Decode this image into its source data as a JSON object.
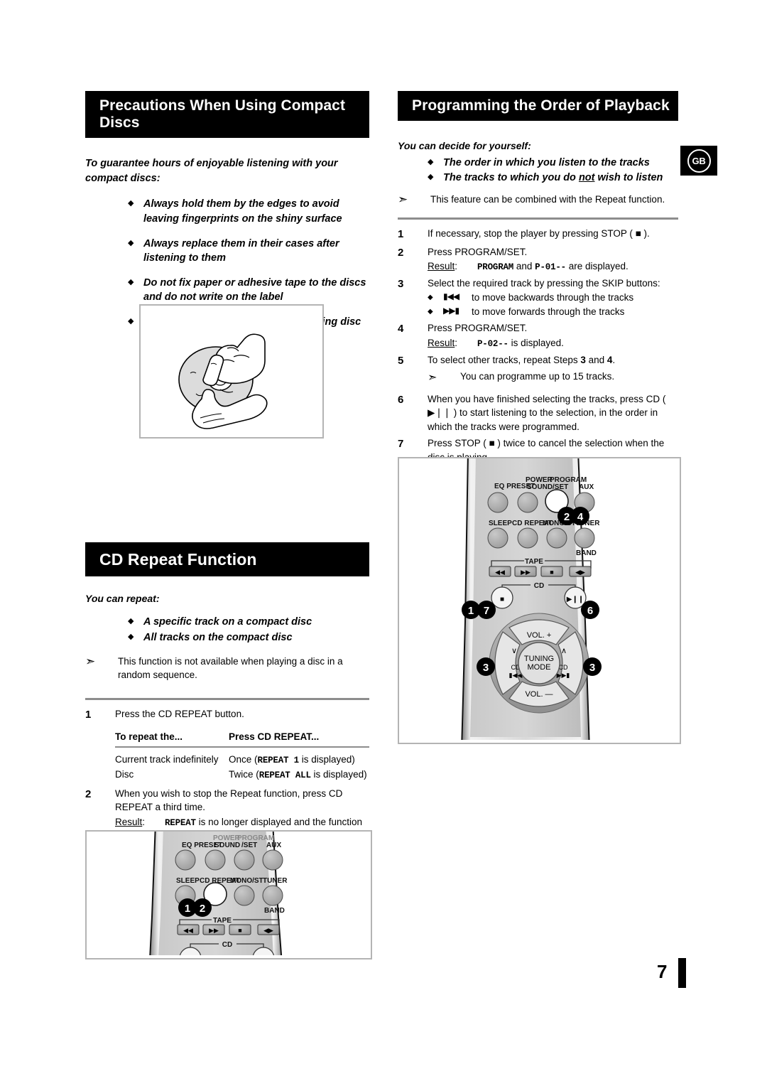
{
  "page": {
    "number": "7",
    "region_badge": "GB"
  },
  "left_column": {
    "section1": {
      "title": "Precautions When Using Compact Discs",
      "intro": "To guarantee hours of enjoyable listening with your compact discs:",
      "bullets": [
        "Always hold them by the edges to avoid leaving fingerprints on the shiny surface",
        "Always replace them in their cases after listening to them",
        "Do not fix paper or adhesive tape to the discs and do not write on the label",
        "Clean the player with a special cleaning disc"
      ],
      "illustration_alt": "Hands cleaning a compact disc with a cloth"
    },
    "section2": {
      "title": "CD Repeat Function",
      "lead": "You can repeat:",
      "bullets": [
        "A specific track on a compact disc",
        "All tracks on the compact disc"
      ],
      "note": "This function is not available when playing a disc in a random sequence.",
      "steps": [
        {
          "num": "1",
          "text": "Press the CD REPEAT button."
        },
        {
          "num": "2",
          "text": "When you wish to stop the Repeat function, press CD REPEAT a third time.",
          "result_label": "Result",
          "result_mono": "REPEAT",
          "result_text": "is no longer displayed and the function is cancelled."
        }
      ],
      "table": {
        "headers": [
          "To repeat the...",
          "Press CD REPEAT..."
        ],
        "rows": [
          {
            "what": "Current track indefinitely",
            "press_pre": "Once (",
            "press_mono": "REPEAT 1",
            "press_post": "is displayed)"
          },
          {
            "what": "Disc",
            "press_pre": "Twice (",
            "press_mono": "REPEAT ALL",
            "press_post": "is displayed)"
          }
        ]
      }
    }
  },
  "right_column": {
    "section": {
      "title": "Programming the Order of Playback",
      "lead": "You can decide for yourself:",
      "bullets": [
        "The order in which you listen to the tracks",
        "The tracks to which you do not wish to listen"
      ],
      "bullet2_parts": {
        "pre": "The tracks to which you do ",
        "underlined": "not",
        "post": " wish to listen"
      },
      "note": "This feature can be combined with the Repeat function.",
      "steps": [
        {
          "num": "1",
          "text": "If necessary, stop the player by pressing STOP ( ■ )."
        },
        {
          "num": "2",
          "text": "Press PROGRAM/SET.",
          "result_label": "Result",
          "result_mono_1": "PROGRAM",
          "result_mid": "and",
          "result_mono_2": "P-01--",
          "result_text": "are displayed."
        },
        {
          "num": "3",
          "text": "Select the required track by pressing the SKIP buttons:",
          "sub_bullets": [
            {
              "symbol": "skip-back-icon",
              "text": "to move backwards through the tracks"
            },
            {
              "symbol": "skip-forward-icon",
              "text": "to move forwards through the tracks"
            }
          ]
        },
        {
          "num": "4",
          "text": "Press PROGRAM/SET.",
          "result_label": "Result",
          "result_mono": "P-02--",
          "result_text": "is displayed."
        },
        {
          "num": "5",
          "text_pre": "To select other tracks, repeat Steps ",
          "ref1": "3",
          "text_mid": " and ",
          "ref2": "4",
          "text_post": ".",
          "note": "You can programme up to 15 tracks."
        },
        {
          "num": "6",
          "text": "When you have finished selecting the tracks, press CD ( ▶❘❘ ) to start listening to the selection, in the order in which the tracks were programmed."
        },
        {
          "num": "7",
          "text": "Press STOP ( ■ ) twice to cancel the selection when the disc is playing."
        }
      ]
    }
  },
  "remote_right": {
    "callouts": [
      "2",
      "4",
      "1",
      "7",
      "6",
      "3",
      "3"
    ],
    "buttons": {
      "row1": [
        "EQ PRESET",
        "POWER SOUND",
        "PROGRAM /SET",
        "AUX"
      ],
      "row2": [
        "SLEEP",
        "CD REPEAT",
        "MONO/ST",
        "TUNER"
      ],
      "row2_sub": "BAND",
      "tape_label": "TAPE",
      "cd_label": "CD",
      "vol_up": "VOL. +",
      "vol_down": "VOL. —",
      "tuning": "TUNING MODE",
      "tuning_line1": "TUNING",
      "tuning_line2": "MODE",
      "cd_left": "CD",
      "cd_right": "CD"
    },
    "highlighted": "PROGRAM /SET"
  },
  "remote_left": {
    "callouts": [
      "1",
      "2"
    ],
    "buttons": {
      "row1": [
        "EQ PRESET",
        "POWER SOUND",
        "PROGRAM /SET",
        "AUX"
      ],
      "row2": [
        "SLEEP",
        "CD REPEAT",
        "MONO/ST",
        "TUNER"
      ],
      "row2_sub": "BAND",
      "tape_label": "TAPE",
      "cd_label": "CD"
    },
    "highlighted": "CD REPEAT"
  }
}
